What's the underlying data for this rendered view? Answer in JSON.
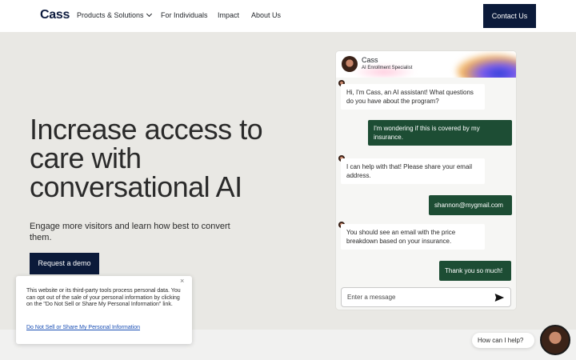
{
  "header": {
    "logo": "Cass",
    "nav": [
      {
        "label": "Products & Solutions"
      },
      {
        "label": "For Individuals"
      },
      {
        "label": "Impact"
      },
      {
        "label": "About Us"
      }
    ],
    "contact_label": "Contact Us"
  },
  "hero": {
    "title": "Increase access to care with conversational AI",
    "subtitle": "Engage more visitors and learn how best to convert them.",
    "demo_label": "Request a demo"
  },
  "chat": {
    "agent_name": "Cass",
    "agent_role": "AI Enrollment Specialist",
    "messages": [
      {
        "from": "bot",
        "text": "Hi, I'm Cass, an AI assistant! What questions do you have about the program?"
      },
      {
        "from": "user",
        "text": "I'm wondering if this is covered by my insurance."
      },
      {
        "from": "bot",
        "text": "I can help with that! Please share your email address."
      },
      {
        "from": "user",
        "text": "shannon@mygmail.com"
      },
      {
        "from": "bot",
        "text": "You should see an email with the price breakdown based on your insurance."
      },
      {
        "from": "user",
        "text": "Thank you so much!"
      }
    ],
    "input_placeholder": "Enter a message",
    "send_icon": "send-icon"
  },
  "cookie": {
    "text": "This website or its third-party tools process personal data. You can opt out of the sale of your personal information by clicking on the \"Do Not Sell or Share My Personal Information\" link.",
    "link": "Do Not Sell or Share My Personal Information",
    "close": "×"
  },
  "help": {
    "label": "How can I help?"
  },
  "colors": {
    "navy": "#0b1a3a",
    "user_bubble": "#1d4d34",
    "page_bg": "#e9e8e4"
  }
}
